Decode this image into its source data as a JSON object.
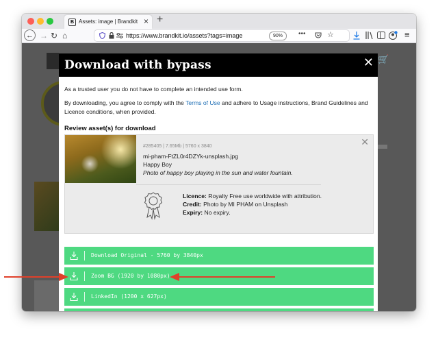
{
  "browser": {
    "tab_title": "Assets: image | Brandkit Brand",
    "tab_favicon": "B",
    "url": "https://www.brandkit.io/assets?tags=image",
    "zoom": "90%",
    "more": "•••"
  },
  "modal": {
    "title": "Download with bypass",
    "intro": "As a trusted user you do not have to complete an intended use form.",
    "agree_prefix": "By downloading, you agree to comply with the ",
    "terms_link": "Terms of Use",
    "agree_suffix": " and adhere to Usage instructions, Brand Guidelines and Licence conditions, when provided.",
    "review_title": "Review asset(s) for download"
  },
  "asset": {
    "meta": "#285405 | 7.65Mb | 5760 x 3840",
    "filename": "mi-pham-FtZL0r4DZYk-unsplash.jpg",
    "name": "Happy Boy",
    "description": "Photo of happy boy playing in the sun and water fountain.",
    "licence_label": "Licence:",
    "licence_value": "Royalty Free use worldwide with attribution.",
    "credit_label": "Credit:",
    "credit_value": "Photo by MI PHAM on Unsplash",
    "expiry_label": "Expiry:",
    "expiry_value": "No expiry."
  },
  "downloads": [
    {
      "label": "Download Original - 5760 by 3840px"
    },
    {
      "label": "Zoom BG (1920 by 1080px)"
    },
    {
      "label": "LinkedIn (1200 x 627px)"
    }
  ],
  "colors": {
    "download_button": "#4ed981",
    "annotation_arrow": "#e0402a",
    "link": "#1f6fb5"
  }
}
